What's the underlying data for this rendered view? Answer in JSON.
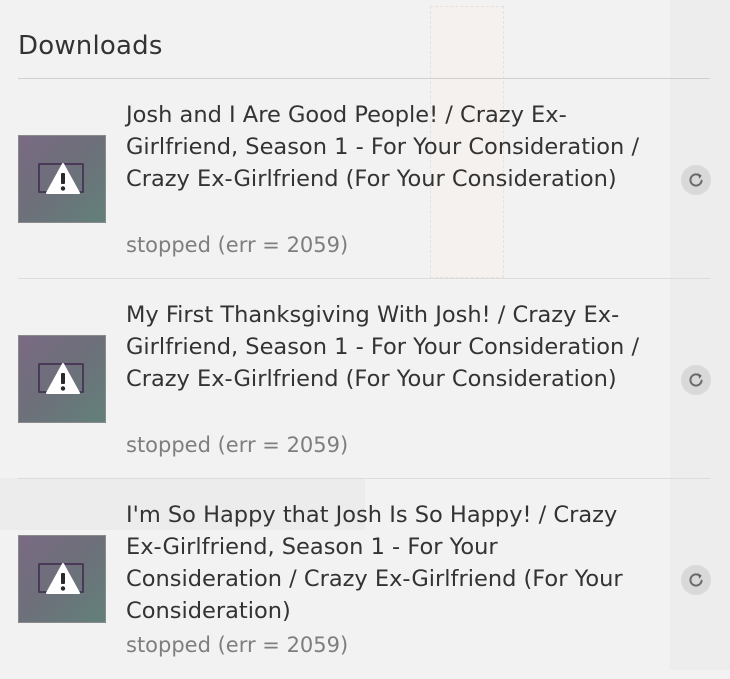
{
  "panel": {
    "title": "Downloads"
  },
  "downloads": [
    {
      "name": "Josh and I Are Good People! / Crazy Ex-Girlfriend, Season 1 - For Your Consideration / Crazy Ex-Girlfriend (For Your Consideration)",
      "status": "stopped (err = 2059)",
      "icon": "warning-icon",
      "action_icon": "retry-icon"
    },
    {
      "name": "My First Thanksgiving With Josh! / Crazy Ex-Girlfriend, Season 1 - For Your Consideration / Crazy Ex-Girlfriend (For Your Consideration)",
      "status": "stopped (err = 2059)",
      "icon": "warning-icon",
      "action_icon": "retry-icon"
    },
    {
      "name": "I'm So Happy that Josh Is So Happy! / Crazy Ex-Girlfriend, Season 1 - For Your Consideration / Crazy Ex-Girlfriend (For Your Consideration)",
      "status": "stopped (err = 2059)",
      "icon": "warning-icon",
      "action_icon": "retry-icon"
    }
  ],
  "colors": {
    "background": "#f2f2f2",
    "text": "#333333",
    "status_text": "#7e7e7e",
    "retry_button": "#d9d9d9"
  }
}
